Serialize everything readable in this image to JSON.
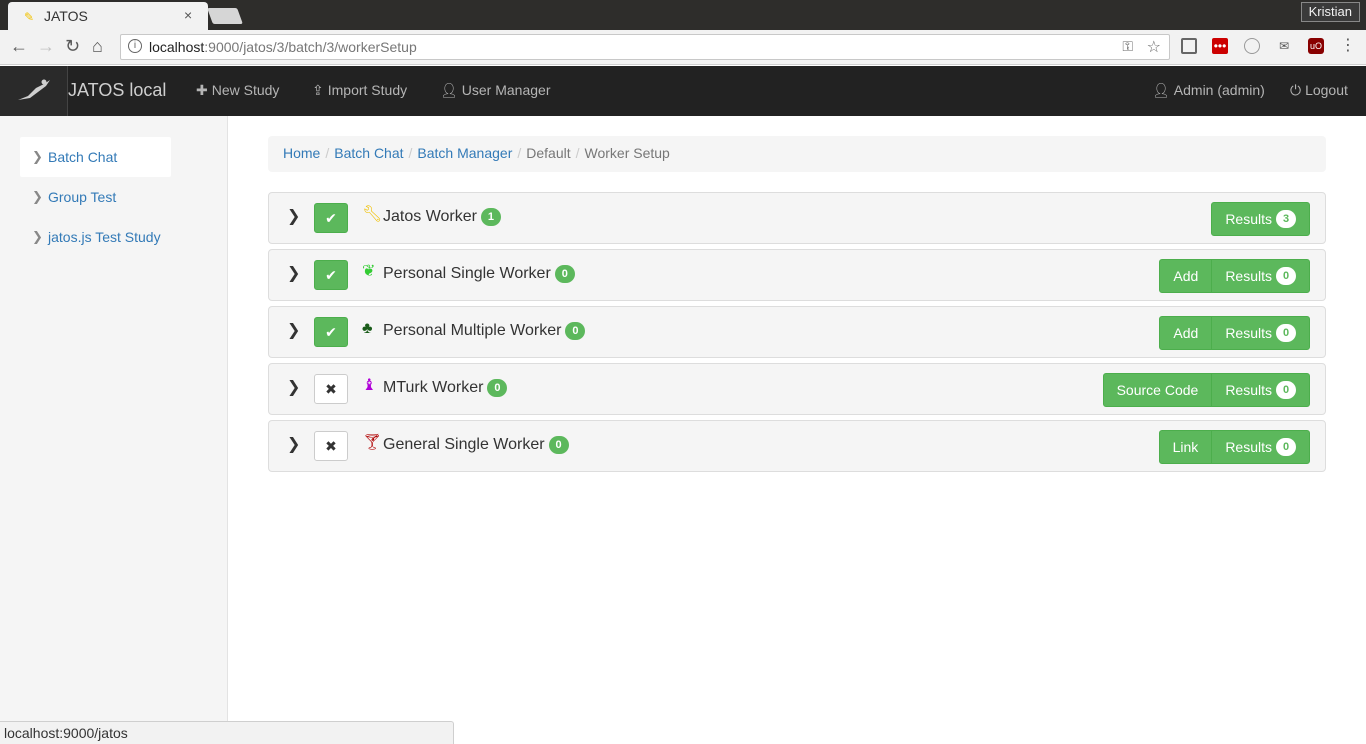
{
  "browser": {
    "tab_title": "JATOS",
    "tab_close": "×",
    "profile": "Kristian",
    "url_host": "localhost",
    "url_path": ":9000/jatos/3/batch/3/workerSetup",
    "status_url": "localhost:9000/jatos",
    "icons": [
      "back-icon",
      "forward-icon",
      "reload-icon",
      "home-icon",
      "info-icon",
      "key-icon",
      "star-icon",
      "menu-icon"
    ]
  },
  "navbar": {
    "brand": "JATOS local",
    "new_study": "New Study",
    "import_study": "Import Study",
    "user_manager": "User Manager",
    "user": "Admin (admin)",
    "logout": "Logout"
  },
  "sidebar": {
    "items": [
      {
        "label": "Batch Chat"
      },
      {
        "label": "Group Test"
      },
      {
        "label": "jatos.js Test Study"
      }
    ]
  },
  "breadcrumb": {
    "home": "Home",
    "batch_chat": "Batch Chat",
    "batch_manager": "Batch Manager",
    "default": "Default",
    "worker_setup": "Worker Setup",
    "separator": "/"
  },
  "workers": [
    {
      "name": "Jatos Worker",
      "count": "1",
      "enabled": true,
      "icon": "wrench-icon",
      "icon_color": "#f0c000",
      "buttons": {
        "results": "Results",
        "results_count": "3"
      }
    },
    {
      "name": "Personal Single Worker",
      "count": "0",
      "enabled": true,
      "icon": "leaf-icon",
      "icon_color": "#33cc33",
      "buttons": {
        "extra": "Add",
        "results": "Results",
        "results_count": "0"
      }
    },
    {
      "name": "Personal Multiple Worker",
      "count": "0",
      "enabled": true,
      "icon": "tree-icon",
      "icon_color": "#1a5c1a",
      "buttons": {
        "extra": "Add",
        "results": "Results",
        "results_count": "0"
      }
    },
    {
      "name": "MTurk Worker",
      "count": "0",
      "enabled": false,
      "icon": "bishop-icon",
      "icon_color": "#b000d8",
      "buttons": {
        "extra": "Source Code",
        "results": "Results",
        "results_count": "0"
      }
    },
    {
      "name": "General Single Worker",
      "count": "0",
      "enabled": false,
      "icon": "glass-icon",
      "icon_color": "#b00000",
      "buttons": {
        "extra": "Link",
        "results": "Results",
        "results_count": "0"
      }
    }
  ],
  "colors": {
    "success": "#5cb85c",
    "link": "#337ab7",
    "navbar": "#222222"
  }
}
